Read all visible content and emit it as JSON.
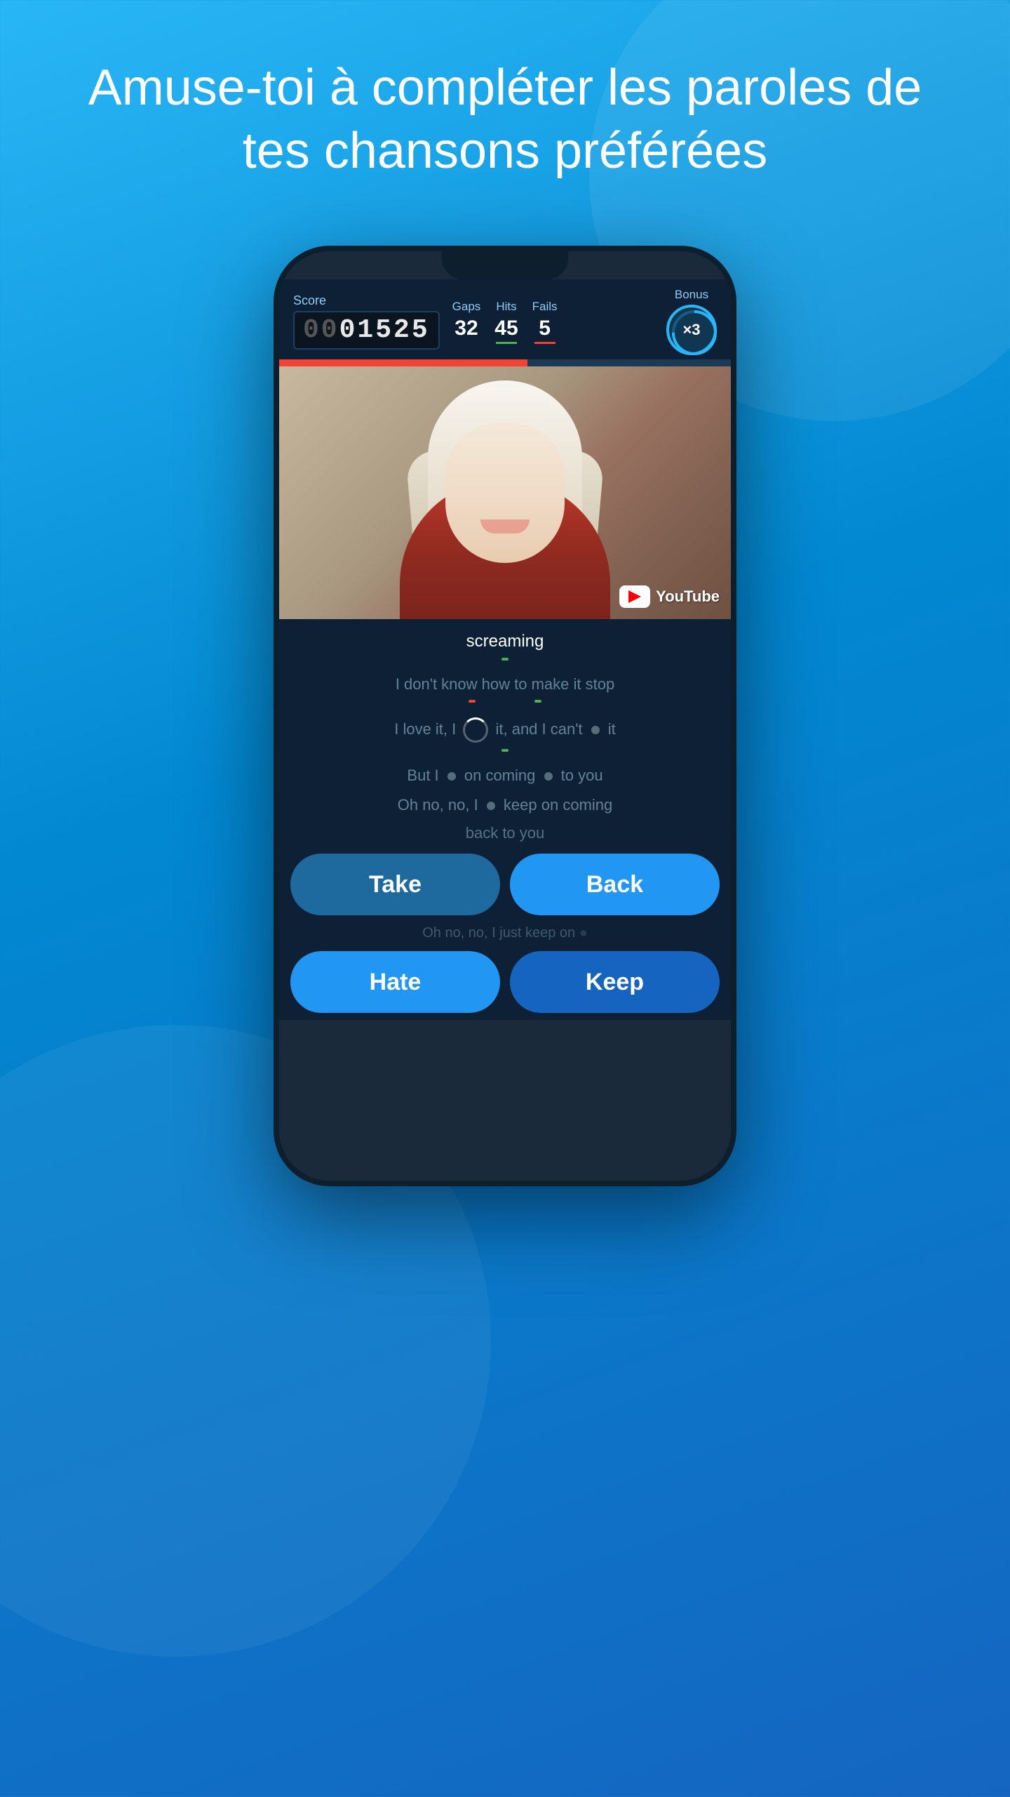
{
  "header": {
    "title": "Amuse-toi  à compléter les paroles de tes chansons préférées"
  },
  "phone": {
    "score": {
      "label": "Score",
      "value": "01525"
    },
    "stats": {
      "gaps_label": "Gaps",
      "gaps_value": "32",
      "hits_label": "Hits",
      "hits_value": "45",
      "fails_label": "Fails",
      "fails_value": "5"
    },
    "bonus": {
      "label": "Bonus",
      "value": "×3"
    },
    "progress_percent": 55,
    "youtube_label": "YouTube",
    "lyrics": [
      {
        "text": "screaming",
        "active": true,
        "indicator": "green"
      },
      {
        "text": "I don't know how to make it stop",
        "active": false,
        "indicators": [
          "red",
          "green"
        ]
      },
      {
        "text": "I love it, I [spinner] it, and I can't [dot] it",
        "active": false,
        "indicator": "green"
      },
      {
        "text": "But I [dot] on coming [dot] to you",
        "active": false
      },
      {
        "text": "Oh no, no, I [dot] keep on coming",
        "active": false
      },
      {
        "text": "back to you",
        "active": false
      }
    ],
    "buttons": {
      "row1": [
        {
          "label": "Take",
          "style": "take"
        },
        {
          "label": "Back",
          "style": "back"
        }
      ],
      "row2": [
        {
          "label": "Hate",
          "style": "hate"
        },
        {
          "label": "Keep",
          "style": "keep"
        }
      ]
    }
  }
}
